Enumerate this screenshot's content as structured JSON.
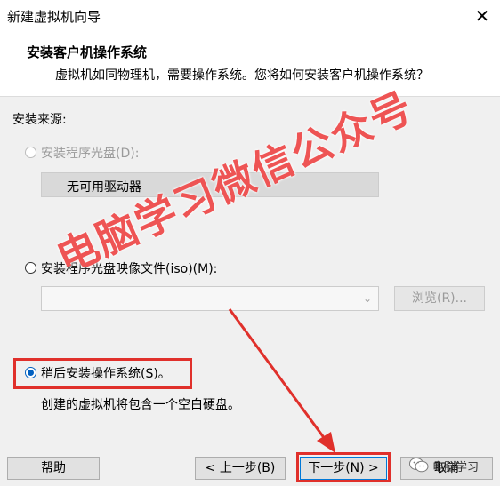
{
  "window": {
    "title": "新建虚拟机向导",
    "close_glyph": "✕"
  },
  "header": {
    "title": "安装客户机操作系统",
    "subtitle": "虚拟机如同物理机，需要操作系统。您将如何安装客户机操作系统？"
  },
  "install_source_label": "安装来源:",
  "options": {
    "disc": {
      "label": "安装程序光盘(D):",
      "enabled": false,
      "selected": false,
      "drive_value": "无可用驱动器"
    },
    "iso": {
      "label": "安装程序光盘映像文件(iso)(M):",
      "enabled": true,
      "selected": false,
      "path_value": "",
      "browse_label": "浏览(R)..."
    },
    "later": {
      "label": "稍后安装操作系统(S)。",
      "enabled": true,
      "selected": true,
      "description": "创建的虚拟机将包含一个空白硬盘。"
    }
  },
  "footer": {
    "help_label": "帮助",
    "back_label": "< 上一步(B)",
    "next_label": "下一步(N) >",
    "cancel_label": "取消"
  },
  "watermark": {
    "text": "电脑学习微信公众号"
  },
  "badge": {
    "text": "电脑学习"
  },
  "colors": {
    "accent_red": "#e0302b",
    "radio_blue": "#0060c0"
  }
}
